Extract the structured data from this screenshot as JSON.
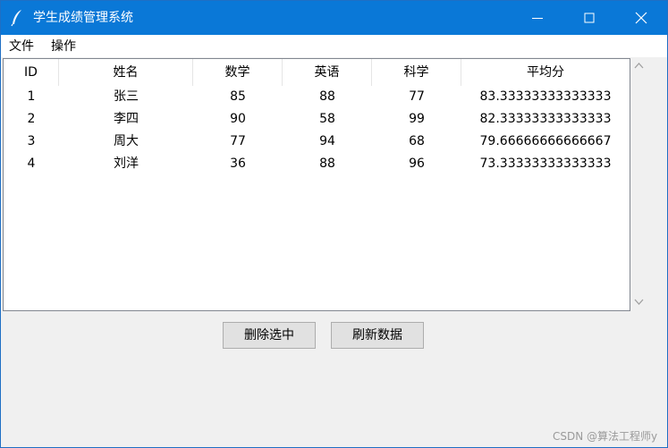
{
  "window": {
    "title": "学生成绩管理系统",
    "icon": "feather-icon",
    "titlebar_color": "#0a78d7"
  },
  "menubar": {
    "items": [
      {
        "label": "文件"
      },
      {
        "label": "操作"
      }
    ]
  },
  "table": {
    "columns": [
      "ID",
      "姓名",
      "数学",
      "英语",
      "科学",
      "平均分"
    ],
    "rows": [
      [
        "1",
        "张三",
        "85",
        "88",
        "77",
        "83.33333333333333"
      ],
      [
        "2",
        "李四",
        "90",
        "58",
        "99",
        "82.33333333333333"
      ],
      [
        "3",
        "周大",
        "77",
        "94",
        "68",
        "79.66666666666667"
      ],
      [
        "4",
        "刘洋",
        "36",
        "88",
        "96",
        "73.33333333333333"
      ]
    ]
  },
  "buttons": {
    "delete_label": "删除选中",
    "refresh_label": "刷新数据"
  },
  "watermark": "CSDN @算法工程师y"
}
